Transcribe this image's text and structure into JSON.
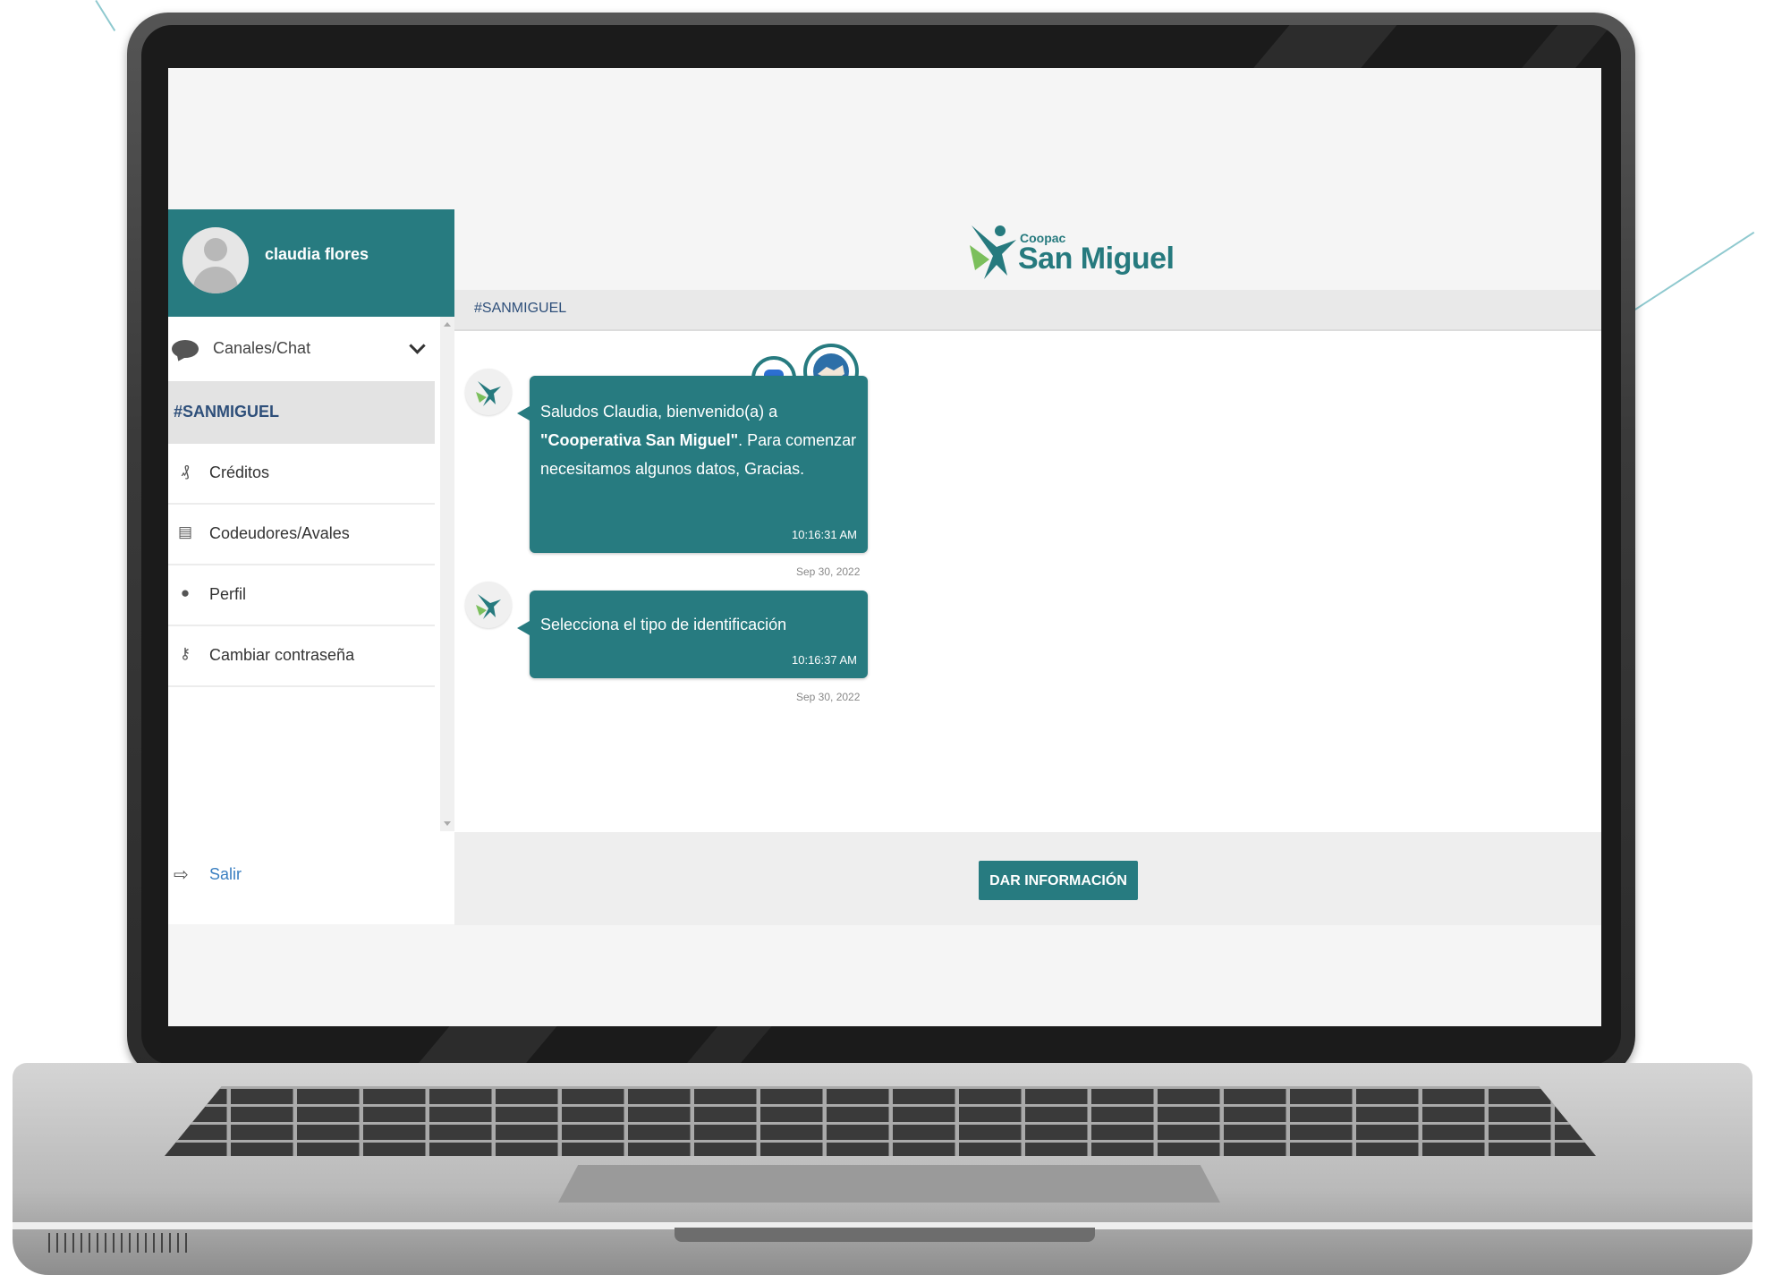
{
  "sidebar": {
    "user_name": "claudia flores",
    "channels_label": "Canales/Chat",
    "active_channel": "#SANMIGUEL",
    "items": [
      {
        "label": "Créditos",
        "icon": "money-icon"
      },
      {
        "label": "Codeudores/Avales",
        "icon": "document-user-icon"
      },
      {
        "label": "Perfil",
        "icon": "user-icon"
      },
      {
        "label": "Cambiar contraseña",
        "icon": "key-icon"
      }
    ],
    "logout_label": "Salir"
  },
  "header": {
    "logo_small": "Coopac",
    "logo_main": "San Miguel"
  },
  "channel_bar": {
    "title": "#SANMIGUEL"
  },
  "messages": [
    {
      "text_part1": "Saludos Claudia, bienvenido(a) a ",
      "text_bold": "\"Cooperativa San Miguel\"",
      "text_part2": ". Para comenzar necesitamos algunos datos, Gracias.",
      "time": "10:16:31 AM",
      "date": "Sep 30, 2022"
    },
    {
      "text": "Selecciona el tipo de identificación",
      "time": "10:16:37 AM",
      "date": "Sep 30, 2022"
    }
  ],
  "action_button": {
    "label": "DAR INFORMACIÓN"
  },
  "colors": {
    "accent": "#277b80",
    "channel_text": "#2e4f7a",
    "link": "#3a7fc1"
  }
}
